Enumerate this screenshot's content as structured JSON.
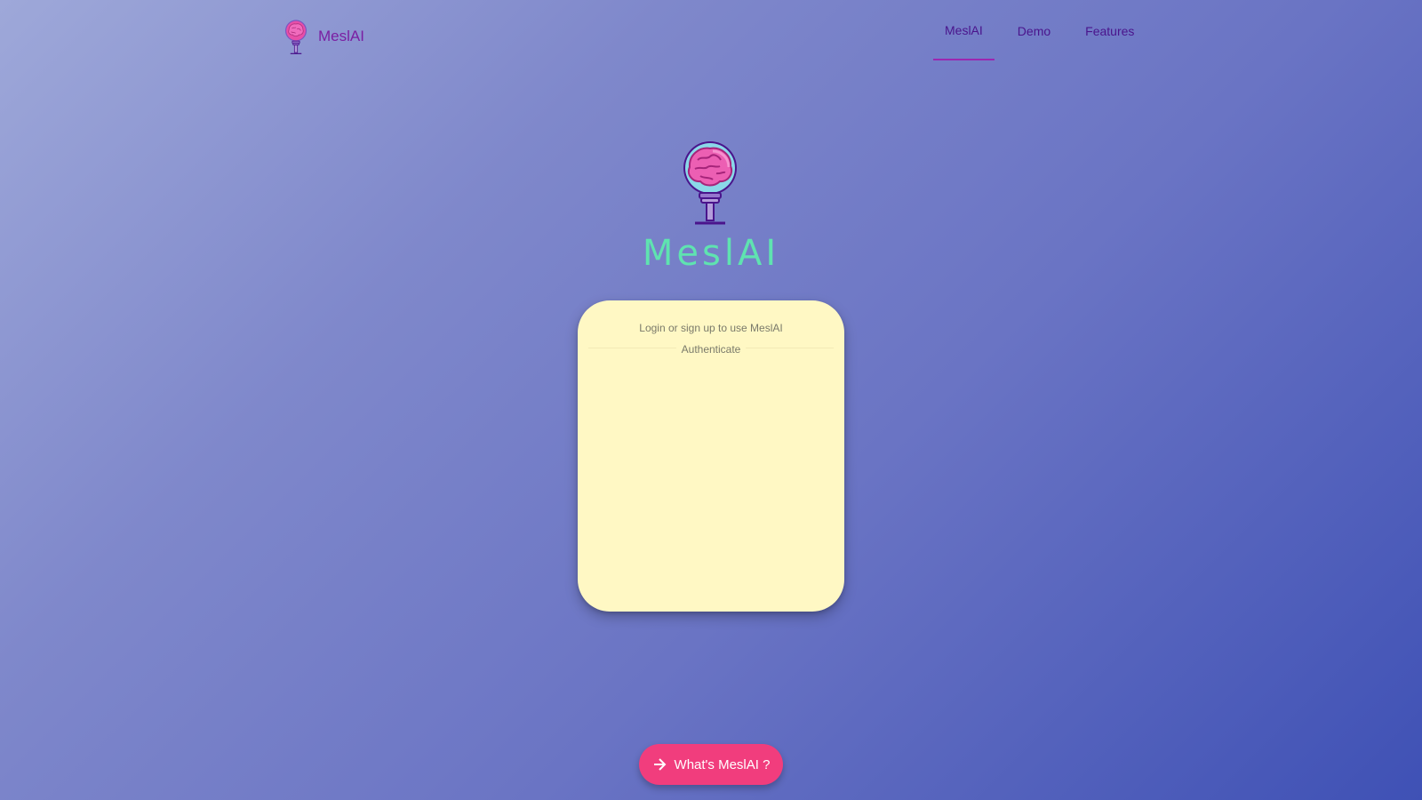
{
  "brand": {
    "name": "MeslAI",
    "logo_icon": "brain-lightbulb-icon"
  },
  "nav": {
    "tabs": [
      {
        "label": "MeslAI",
        "active": true
      },
      {
        "label": "Demo",
        "active": false
      },
      {
        "label": "Features",
        "active": false
      }
    ]
  },
  "hero": {
    "title": "MeslAI",
    "logo_icon": "brain-lightbulb-icon"
  },
  "auth": {
    "prompt": "Login or sign up to use MeslAI",
    "section_label": "Authenticate"
  },
  "cta": {
    "label": "What's MeslAI ?",
    "icon": "arrow-right-icon"
  },
  "colors": {
    "accent_pink": "#f13d7d",
    "title_green": "#5fe3b0",
    "card_background": "#fff8c4",
    "nav_text": "#4a148c",
    "active_tab_indicator": "#9c27b0"
  }
}
